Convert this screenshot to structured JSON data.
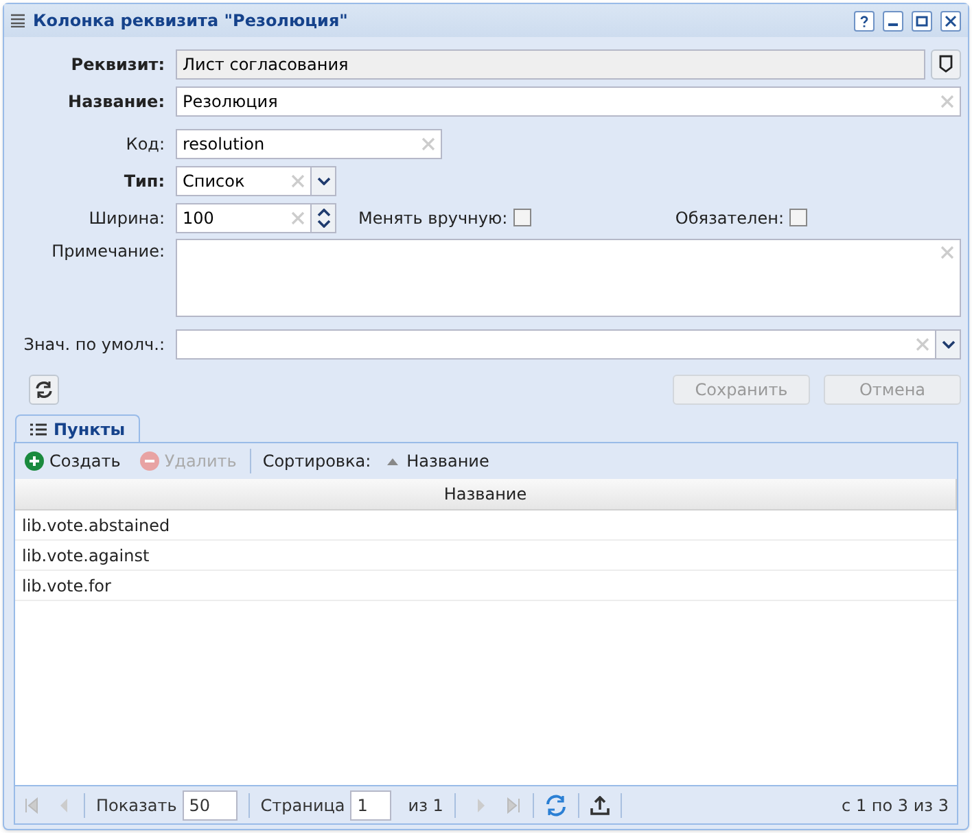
{
  "window": {
    "title": "Колонка реквизита \"Резолюция\""
  },
  "form": {
    "requisite": {
      "label": "Реквизит:",
      "value": "Лист согласования",
      "disabled": true
    },
    "name": {
      "label": "Название:",
      "value": "Резолюция"
    },
    "code": {
      "label": "Код:",
      "value": "resolution"
    },
    "type": {
      "label": "Тип:",
      "value": "Список"
    },
    "width": {
      "label": "Ширина:",
      "value": "100"
    },
    "manual": {
      "label": "Менять вручную:",
      "checked": false
    },
    "required": {
      "label": "Обязателен:",
      "checked": false
    },
    "note": {
      "label": "Примечание:"
    },
    "default": {
      "label": "Знач. по умолч.:"
    },
    "buttons": [
      {
        "label": "Сохранить",
        "disabled": true
      },
      {
        "label": "Отмена",
        "disabled": true
      }
    ]
  },
  "tabs": [
    {
      "label": "Пункты",
      "selected": true
    }
  ],
  "toolbar": {
    "create": {
      "label": "Создать",
      "disabled": false
    },
    "delete": {
      "label": "Удалить",
      "disabled": true
    },
    "sort_label": "Сортировка:",
    "sort_field": "Название"
  },
  "table": {
    "columns": [
      "Название"
    ],
    "rows": [
      {
        "cells": [
          "lib.vote.abstained"
        ]
      },
      {
        "cells": [
          "lib.vote.against"
        ]
      },
      {
        "cells": [
          "lib.vote.for"
        ]
      }
    ]
  },
  "pager": {
    "show_label": "Показать",
    "page_size": "50",
    "page_label": "Страница",
    "page": "1",
    "of_pages": "из 1",
    "summary": "с 1 по 3 из 3"
  }
}
